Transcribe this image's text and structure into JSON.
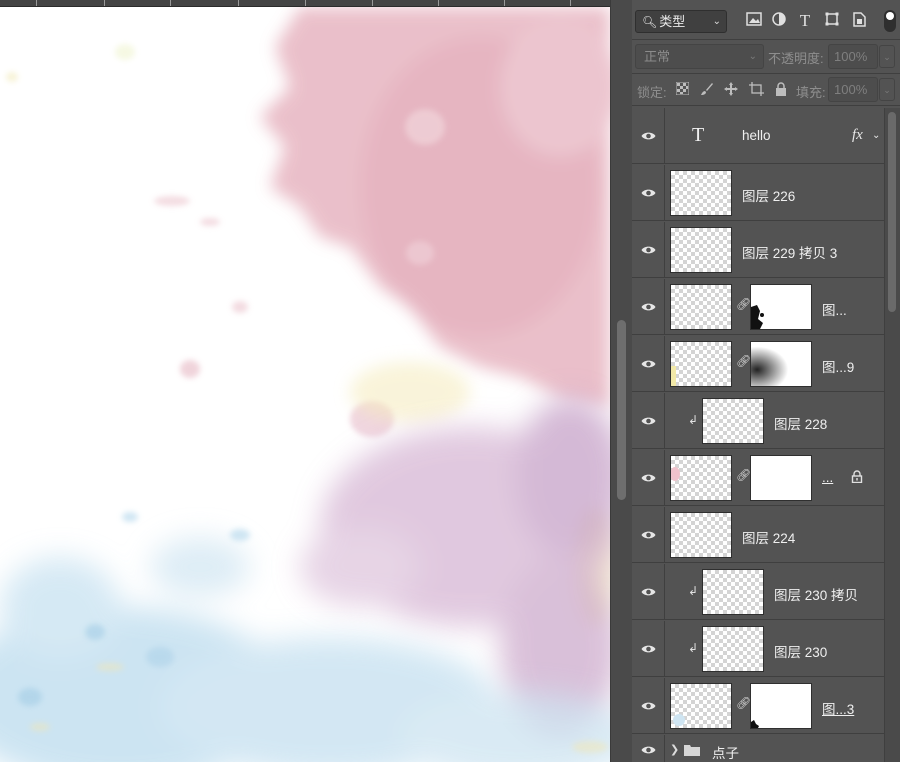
{
  "panel": {
    "filter": {
      "search_icon": "magnifier-icon",
      "select_label": "类型",
      "icons": [
        "image-filter-icon",
        "adjustment-filter-icon",
        "type-filter-icon",
        "shape-filter-icon",
        "smart-object-filter-icon"
      ]
    },
    "blend": {
      "mode": "正常",
      "opacity_label": "不透明度:",
      "opacity_value": "100%"
    },
    "lock": {
      "label": "锁定:",
      "icons": [
        "lock-pixels-icon",
        "lock-image-icon",
        "lock-position-icon",
        "lock-artboard-icon",
        "lock-all-icon"
      ],
      "fill_label": "填充:",
      "fill_value": "100%"
    }
  },
  "layers": [
    {
      "name": "hello",
      "kind": "text",
      "fx": "fx"
    },
    {
      "name": "图层 226",
      "kind": "pixel"
    },
    {
      "name": "图层 229 拷贝 3",
      "kind": "pixel"
    },
    {
      "name": "图...",
      "kind": "masked"
    },
    {
      "name": "图...9",
      "kind": "masked"
    },
    {
      "name": "图层 228",
      "kind": "clipped"
    },
    {
      "name": "...",
      "kind": "masked-locked"
    },
    {
      "name": "图层 224",
      "kind": "pixel"
    },
    {
      "name": "图层 230 拷贝",
      "kind": "clipped"
    },
    {
      "name": "图层 230",
      "kind": "clipped"
    },
    {
      "name": "图...3",
      "kind": "masked"
    },
    {
      "name": "点子",
      "kind": "group"
    }
  ],
  "colors": {
    "panel_bg": "#535353",
    "canvas_bg": "#ffffff",
    "watercolor_pink": "#e8b8c4",
    "watercolor_purple": "#c9a3c8",
    "watercolor_blue": "#bcdcee",
    "watercolor_yellow": "#f5ecc0"
  }
}
